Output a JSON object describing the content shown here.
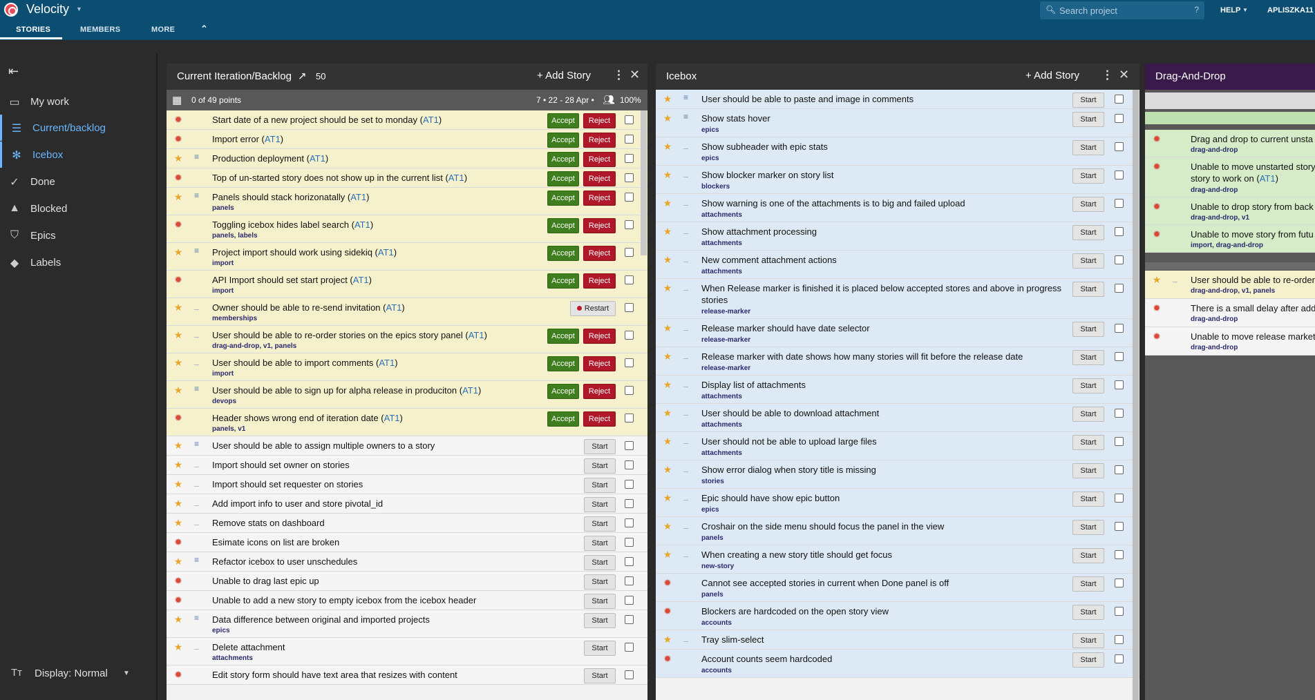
{
  "app": {
    "title": "Velocity"
  },
  "tabs": [
    "STORIES",
    "MEMBERS",
    "MORE"
  ],
  "search": {
    "placeholder": "Search project",
    "help": "?"
  },
  "header": {
    "help": "HELP",
    "user": "APLISZKA11"
  },
  "sidebar": {
    "items": [
      {
        "label": "My work",
        "icon": "inbox-icon"
      },
      {
        "label": "Current/backlog",
        "icon": "list-icon",
        "active": true
      },
      {
        "label": "Icebox",
        "icon": "snowflake-icon",
        "active": true
      },
      {
        "label": "Done",
        "icon": "check-icon"
      },
      {
        "label": "Blocked",
        "icon": "warning-icon"
      },
      {
        "label": "Epics",
        "icon": "shield-icon"
      },
      {
        "label": "Labels",
        "icon": "tag-icon"
      }
    ],
    "display": "Display: Normal"
  },
  "colors": {
    "topbar": "#0c4e72",
    "current_row": "#f5f1cc",
    "icebox_row": "#dde9f4",
    "dd_header": "#3a1a4a",
    "accept": "#3f7e1e",
    "reject": "#b0182a"
  },
  "current": {
    "title": "Current Iteration/Backlog",
    "velocity": "50",
    "add_story": "Add Story",
    "points": "0 of 49 points",
    "dates": "7 • 22 - 28 Apr •",
    "percent": "100%",
    "accept_label": "Accept",
    "reject_label": "Reject",
    "start_label": "Start",
    "restart_label": "Restart",
    "stories": [
      {
        "type": "bug",
        "est": "",
        "title": "Start date of a new project should be set to monday",
        "owner": "AT1",
        "labels": "",
        "state": "finished"
      },
      {
        "type": "bug",
        "est": "",
        "title": "Import error",
        "owner": "AT1",
        "labels": "",
        "state": "finished"
      },
      {
        "type": "feature",
        "est": "≡",
        "title": "Production deployment",
        "owner": "AT1",
        "labels": "",
        "state": "finished"
      },
      {
        "type": "bug",
        "est": "",
        "title": "Top of un-started story does not show up in the current list",
        "owner": "AT1",
        "labels": "",
        "state": "finished"
      },
      {
        "type": "feature",
        "est": "≡",
        "title": "Panels should stack horizonatally",
        "owner": "AT1",
        "labels": "panels",
        "state": "finished"
      },
      {
        "type": "bug",
        "est": "",
        "title": "Toggling icebox hides label search",
        "owner": "AT1",
        "labels": "panels, labels",
        "state": "finished"
      },
      {
        "type": "feature",
        "est": "≡",
        "title": "Project import should work using sidekiq",
        "owner": "AT1",
        "labels": "import",
        "state": "finished"
      },
      {
        "type": "bug",
        "est": "",
        "title": "API Import should set start project",
        "owner": "AT1",
        "labels": "import",
        "state": "finished"
      },
      {
        "type": "feature",
        "est": "_",
        "title": "Owner should be able to re-send invitation",
        "owner": "AT1",
        "labels": "memberships",
        "state": "rejected"
      },
      {
        "type": "feature",
        "est": "_",
        "title": "User should be able to re-order stories on the epics story panel",
        "owner": "AT1",
        "labels": "drag-and-drop, v1, panels",
        "state": "finished"
      },
      {
        "type": "feature",
        "est": "_",
        "title": "User should be able to import comments",
        "owner": "AT1",
        "labels": "import",
        "state": "finished"
      },
      {
        "type": "feature",
        "est": "≡",
        "title": "User should be able to sign up for alpha release in produciton",
        "owner": "AT1",
        "labels": "devops",
        "state": "finished"
      },
      {
        "type": "bug",
        "est": "",
        "title": "Header shows wrong end of iteration date",
        "owner": "AT1",
        "labels": "panels, v1",
        "state": "finished"
      },
      {
        "type": "feature",
        "est": "≡",
        "title": "User should be able to assign multiple owners to a story",
        "owner": "",
        "labels": "",
        "state": "unstarted"
      },
      {
        "type": "feature",
        "est": "_",
        "title": "Import should set owner on stories",
        "owner": "",
        "labels": "",
        "state": "unstarted"
      },
      {
        "type": "feature",
        "est": "_",
        "title": "Import should set requester on stories",
        "owner": "",
        "labels": "",
        "state": "unstarted"
      },
      {
        "type": "feature",
        "est": "_",
        "title": "Add import info to user and store pivotal_id",
        "owner": "",
        "labels": "",
        "state": "unstarted"
      },
      {
        "type": "feature",
        "est": "_",
        "title": "Remove stats on dashboard",
        "owner": "",
        "labels": "",
        "state": "unstarted"
      },
      {
        "type": "bug",
        "est": "",
        "title": "Esimate icons on list are broken",
        "owner": "",
        "labels": "",
        "state": "unstarted"
      },
      {
        "type": "feature",
        "est": "≡",
        "title": "Refactor icebox to user unschedules",
        "owner": "",
        "labels": "",
        "state": "unstarted"
      },
      {
        "type": "bug",
        "est": "",
        "title": "Unable to drag last epic up",
        "owner": "",
        "labels": "",
        "state": "unstarted"
      },
      {
        "type": "bug",
        "est": "",
        "title": "Unable to add a new story to empty icebox from the icebox header",
        "owner": "",
        "labels": "",
        "state": "unstarted"
      },
      {
        "type": "feature",
        "est": "≡",
        "title": "Data difference between original and imported projects",
        "owner": "",
        "labels": "epics",
        "state": "unstarted"
      },
      {
        "type": "feature",
        "est": "_",
        "title": "Delete attachment",
        "owner": "",
        "labels": "attachments",
        "state": "unstarted"
      },
      {
        "type": "bug",
        "est": "",
        "title": "Edit story form should have text area that resizes with content",
        "owner": "",
        "labels": "",
        "state": "unstarted"
      }
    ]
  },
  "icebox": {
    "title": "Icebox",
    "add_story": "Add Story",
    "start_label": "Start",
    "stories": [
      {
        "type": "feature",
        "est": "≡",
        "title": "User should be able to paste and image in comments",
        "labels": ""
      },
      {
        "type": "feature",
        "est": "≡",
        "title": "Show stats hover",
        "labels": "epics"
      },
      {
        "type": "feature",
        "est": "_",
        "title": "Show subheader with epic stats",
        "labels": "epics"
      },
      {
        "type": "feature",
        "est": "_",
        "title": "Show blocker marker on story list",
        "labels": "blockers"
      },
      {
        "type": "feature",
        "est": "_",
        "title": "Show warning is one of the attachments is to big and failed upload",
        "labels": "attachments"
      },
      {
        "type": "feature",
        "est": "_",
        "title": "Show attachment processing",
        "labels": "attachments"
      },
      {
        "type": "feature",
        "est": "_",
        "title": "New comment attachment actions",
        "labels": "attachments"
      },
      {
        "type": "feature",
        "est": "_",
        "title": "When Release marker is finished it is placed below accepted stores and above in progress stories",
        "labels": "release-marker",
        "tall": true
      },
      {
        "type": "feature",
        "est": "_",
        "title": "Release marker should have date selector",
        "labels": "release-marker"
      },
      {
        "type": "feature",
        "est": "_",
        "title": "Release marker with date shows how many stories will fit before the release date",
        "labels": "release-marker"
      },
      {
        "type": "feature",
        "est": "_",
        "title": "Display list of attachments",
        "labels": "attachments"
      },
      {
        "type": "feature",
        "est": "_",
        "title": "User should be able to download attachment",
        "labels": "attachments"
      },
      {
        "type": "feature",
        "est": "_",
        "title": "User should not be able to upload large files",
        "labels": "attachments"
      },
      {
        "type": "feature",
        "est": "_",
        "title": "Show error dialog when story title is missing",
        "labels": "stories"
      },
      {
        "type": "feature",
        "est": "_",
        "title": "Epic should have show epic button",
        "labels": "epics"
      },
      {
        "type": "feature",
        "est": "_",
        "title": "Croshair on the side menu should focus the panel in the view",
        "labels": "panels"
      },
      {
        "type": "feature",
        "est": "_",
        "title": "When creating a new story title should get focus",
        "labels": "new-story"
      },
      {
        "type": "bug",
        "est": "",
        "title": "Cannot see accepted stories in current when Done panel is off",
        "labels": "panels"
      },
      {
        "type": "bug",
        "est": "",
        "title": "Blockers are hardcoded on the open story view",
        "labels": "accounts"
      },
      {
        "type": "feature",
        "est": "_",
        "title": "Tray slim-select",
        "labels": ""
      },
      {
        "type": "bug",
        "est": "",
        "title": "Account counts seem hardcoded",
        "labels": "accounts"
      }
    ]
  },
  "dragdrop": {
    "title": "Drag-And-Drop",
    "green": [
      {
        "type": "bug",
        "title": "Drag and drop to current unsta",
        "owner": "",
        "labels": "drag-and-drop"
      },
      {
        "type": "bug",
        "title": "Unable to move unstarted story",
        "line2": "story to work on ",
        "owner": "AT1",
        "labels": "drag-and-drop",
        "tall": true
      },
      {
        "type": "bug",
        "title": "Unable to drop story from back",
        "owner": "",
        "labels": "drag-and-drop, v1"
      },
      {
        "type": "bug",
        "title": "Unable to move story from futu",
        "owner": "",
        "labels": "import, drag-and-drop"
      }
    ],
    "other": [
      {
        "type": "feature",
        "est": "_",
        "title": "User should be able to re-order",
        "labels": "drag-and-drop, v1, panels",
        "color": "#f5f1cc"
      },
      {
        "type": "bug",
        "est": "",
        "title": "There is a small delay after addi",
        "labels": "drag-and-drop",
        "color": "#f5f5f5"
      },
      {
        "type": "bug",
        "est": "",
        "title": "Unable to move release market",
        "labels": "drag-and-drop",
        "color": "#f5f5f5"
      }
    ]
  }
}
